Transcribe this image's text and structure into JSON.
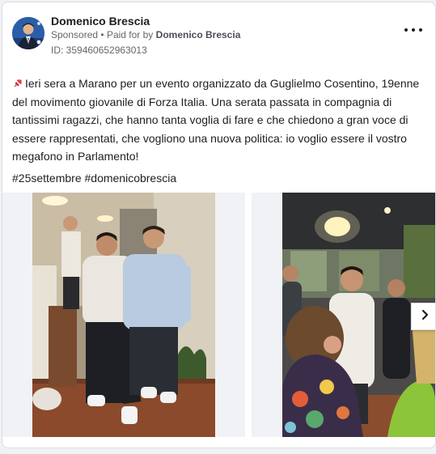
{
  "post": {
    "page_name": "Domenico Brescia",
    "sponsored_label": "Sponsored",
    "separator": "•",
    "paid_for_prefix": "Paid for by",
    "paid_for_by": "Domenico Brescia",
    "ad_id": "ID: 359460652963013",
    "body_text": "Ieri sera a Marano per un evento organizzato da Guglielmo Cosentino, 19enne del movimento giovanile di Forza Italia. Una serata passata in compagnia di tantissimi ragazzi, che hanno tanta voglia di fare e che chiedono a gran voce di essere rappresentati, che vogliono una nuova politica: io voglio essere il vostro megafono in Parlamento!",
    "hashtags": "#25settembre #domenicobrescia"
  },
  "icons": {
    "pin": "pushpin-icon",
    "more": "more-options-icon",
    "next": "chevron-right-icon"
  },
  "colors": {
    "text_primary": "#1c1e21",
    "text_secondary": "#65676b",
    "background": "#f0f2f5",
    "card": "#ffffff"
  }
}
